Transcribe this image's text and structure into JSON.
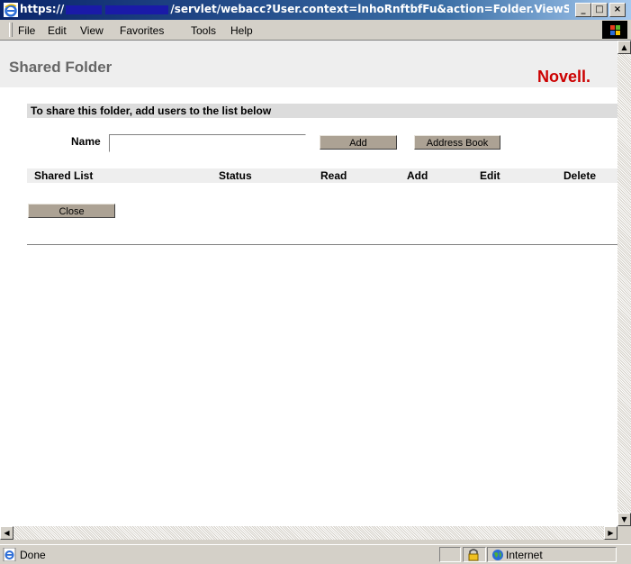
{
  "window": {
    "title_prefix": "https://",
    "title_suffix": "/servlet/webacc?User.context=lnhoRnftbfFu&action=Folder.ViewShare...",
    "controls": [
      "_",
      "□",
      "×"
    ]
  },
  "menu": {
    "items": [
      "File",
      "Edit",
      "View",
      "Favorites",
      "Tools",
      "Help"
    ]
  },
  "page": {
    "title": "Shared Folder",
    "brand": "Novell.",
    "instruction": "To share this folder, add users to the list below",
    "name_label": "Name",
    "name_value": "",
    "add_button": "Add",
    "address_book_button": "Address Book",
    "columns": [
      "Shared List",
      "Status",
      "Read",
      "Add",
      "Edit",
      "Delete"
    ],
    "close_button": "Close"
  },
  "status": {
    "text": "Done",
    "zone": "Internet"
  },
  "colors": {
    "title_bar": "#0a246a",
    "brand_red": "#cc0000",
    "button_bg": "#aca294",
    "chrome": "#d4d0c8"
  }
}
